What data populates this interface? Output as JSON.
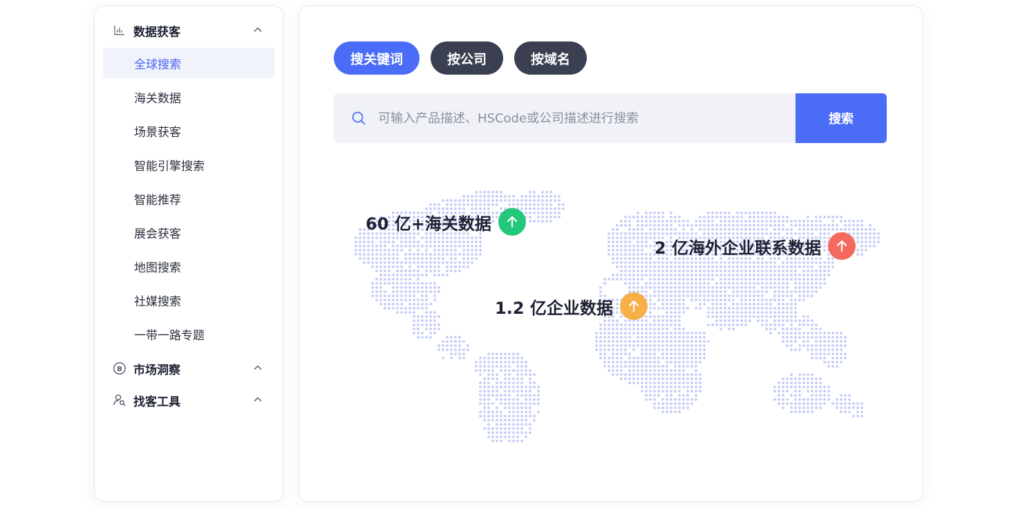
{
  "sidebar": {
    "groups": [
      {
        "label": "数据获客",
        "icon": "bar-chart-icon",
        "expanded": true,
        "items": [
          "全球搜索",
          "海关数据",
          "场景获客",
          "智能引擎搜索",
          "智能推荐",
          "展会获客",
          "地图搜索",
          "社媒搜索",
          "一带一路专题"
        ],
        "active_item": "全球搜索"
      },
      {
        "label": "市场洞察",
        "icon": "bitcoin-circle-icon"
      },
      {
        "label": "找客工具",
        "icon": "user-search-icon"
      }
    ]
  },
  "main": {
    "tabs": [
      {
        "label": "搜关键词",
        "active": true
      },
      {
        "label": "按公司",
        "active": false
      },
      {
        "label": "按域名",
        "active": false
      }
    ],
    "search": {
      "placeholder": "可输入产品描述、HSCode或公司描述进行搜索",
      "value": "",
      "button": "搜索"
    },
    "stats": [
      {
        "text": "60 亿+海关数据",
        "color": "#22c77a"
      },
      {
        "text": "2 亿海外企业联系数据",
        "color": "#f46a5e"
      },
      {
        "text": "1.2 亿企业数据",
        "color": "#f7b045"
      }
    ]
  },
  "colors": {
    "accent": "#4a6cf7",
    "tab_inactive": "#3a3f52",
    "map_dots": "#c3cbf6"
  }
}
